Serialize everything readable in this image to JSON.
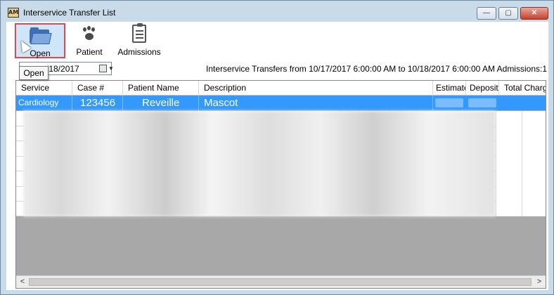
{
  "window": {
    "title": "Interservice Transfer List",
    "app_icon_text": "AM",
    "min_glyph": "—",
    "max_glyph": "▢",
    "close_glyph": "✕"
  },
  "toolbar": {
    "open_label": "Open",
    "patient_label": "Patient",
    "admissions_label": "Admissions"
  },
  "tooltip": {
    "text": "Open"
  },
  "filter": {
    "date_value": "/18/2017",
    "dropdown_glyph": "▼",
    "info_text": "Interservice Transfers from 10/17/2017 6:00:00 AM to 10/18/2017 6:00:00 AM Admissions:1"
  },
  "grid": {
    "columns": [
      "Service",
      "Case #",
      "Patient Name",
      "Description",
      "Estimate",
      "Deposit",
      "Total Charg"
    ],
    "selected_row": {
      "service": "Cardiology",
      "case_number": "123456",
      "patient_name": "Reveille",
      "description": "Mascot"
    }
  },
  "scrollbar": {
    "left_glyph": "<",
    "right_glyph": ">"
  },
  "colors": {
    "selection": "#3399ff",
    "highlight_border": "#e0484f",
    "title_bar": "#c9dbe9",
    "grid_empty_area": "#a8a8a8"
  }
}
